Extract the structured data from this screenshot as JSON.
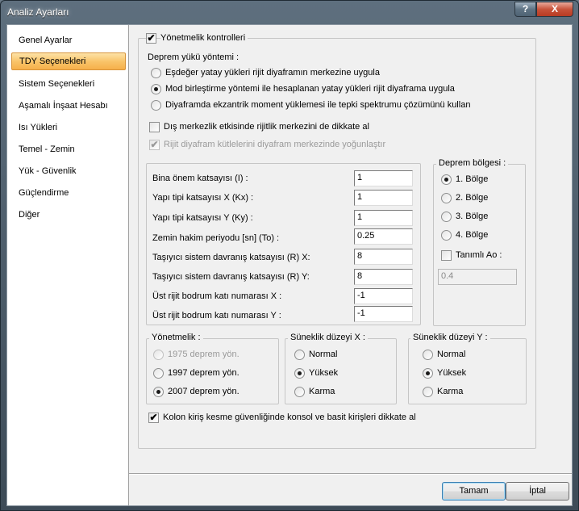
{
  "window": {
    "title": "Analiz Ayarları",
    "help_glyph": "?",
    "close_glyph": "X"
  },
  "sidebar": {
    "items": [
      {
        "label": "Genel Ayarlar"
      },
      {
        "label": "TDY Seçenekleri",
        "selected": true
      },
      {
        "label": "Sistem Seçenekleri"
      },
      {
        "label": "Aşamalı İnşaat Hesabı"
      },
      {
        "label": "Isı Yükleri"
      },
      {
        "label": "Temel - Zemin"
      },
      {
        "label": "Yük - Güvenlik"
      },
      {
        "label": "Güçlendirme"
      },
      {
        "label": "Diğer"
      }
    ]
  },
  "main": {
    "yonetmelik_kontrolleri": {
      "label": "Yönetmelik kontrolleri",
      "checked": true
    },
    "deprem_yuku_yontemi": {
      "heading": "Deprem yükü yöntemi :",
      "options": [
        {
          "label": "Eşdeğer yatay yükleri rijit diyaframın merkezine uygula",
          "selected": false
        },
        {
          "label": "Mod birleştirme yöntemi ile hesaplanan yatay yükleri rijit diyaframa uygula",
          "selected": true
        },
        {
          "label": "Diyaframda ekzantrik moment yüklemesi ile tepki spektrumu çözümünü kullan",
          "selected": false
        }
      ]
    },
    "dis_merkezlik": {
      "label": "Dış merkezlik etkisinde rijitlik merkezini de dikkate al",
      "checked": false
    },
    "rijit_diyafram": {
      "label": "Rijit diyafram kütlelerini diyafram merkezinde yoğunlaştır",
      "checked": true,
      "disabled": true
    },
    "parameters": [
      {
        "label": "Bina önem katsayısı (I) :",
        "value": "1"
      },
      {
        "label": "Yapı tipi katsayısı X (Kx) :",
        "value": "1"
      },
      {
        "label": "Yapı tipi katsayısı Y (Ky) :",
        "value": "1"
      },
      {
        "label": "Zemin hakim periyodu [sn] (To)  :",
        "value": "0.25"
      },
      {
        "label": "Taşıyıcı sistem davranış katsayısı (R) X:",
        "value": "8"
      },
      {
        "label": "Taşıyıcı sistem davranış katsayısı (R) Y:",
        "value": "8"
      },
      {
        "label": "Üst rijit bodrum katı numarası X :",
        "value": "-1"
      },
      {
        "label": "Üst rijit bodrum katı numarası Y :",
        "value": "-1"
      }
    ],
    "deprem_bolgesi": {
      "legend": "Deprem bölgesi :",
      "options": [
        {
          "label": "1. Bölge",
          "selected": true
        },
        {
          "label": "2. Bölge",
          "selected": false
        },
        {
          "label": "3. Bölge",
          "selected": false
        },
        {
          "label": "4. Bölge",
          "selected": false
        }
      ],
      "tanimli_ao": {
        "label": "Tanımlı Ao :",
        "checked": false
      },
      "ao_value": "0.4"
    },
    "yonetmelik": {
      "legend": "Yönetmelik :",
      "options": [
        {
          "label": "1975 deprem yön.",
          "selected": false,
          "disabled": true
        },
        {
          "label": "1997 deprem yön.",
          "selected": false
        },
        {
          "label": "2007 deprem yön.",
          "selected": true
        }
      ]
    },
    "suneklik_x": {
      "legend": "Süneklik düzeyi X :",
      "options": [
        {
          "label": "Normal",
          "selected": false
        },
        {
          "label": "Yüksek",
          "selected": true
        },
        {
          "label": "Karma",
          "selected": false
        }
      ]
    },
    "suneklik_y": {
      "legend": "Süneklik düzeyi Y :",
      "options": [
        {
          "label": "Normal",
          "selected": false
        },
        {
          "label": "Yüksek",
          "selected": true
        },
        {
          "label": "Karma",
          "selected": false
        }
      ]
    },
    "kolon_kiris": {
      "label": "Kolon kiriş kesme güvenliğinde konsol ve basit kirişleri dikkate al",
      "checked": true
    }
  },
  "footer": {
    "ok_label": "Tamam",
    "cancel_label": "İptal"
  },
  "check_glyph": "✔"
}
